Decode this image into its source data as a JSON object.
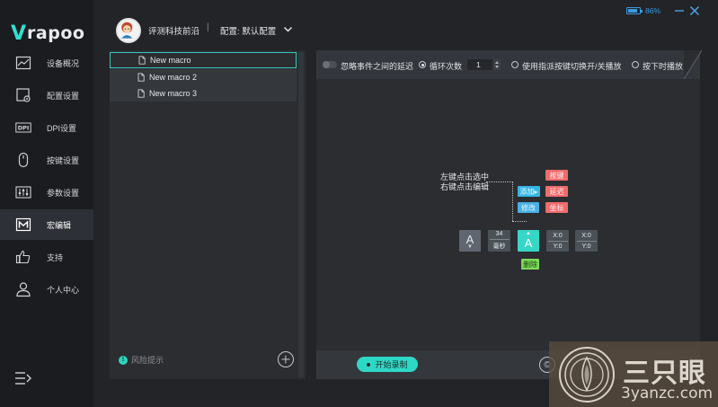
{
  "brand": {
    "logo_mark": "V",
    "logo_word": "rapoo"
  },
  "user": {
    "name": "评测科技前沿",
    "separator": "|",
    "profile": "配置: 默认配置"
  },
  "battery": {
    "level": 86,
    "text": "86%"
  },
  "sidebar": {
    "items": [
      {
        "label": "设备概况",
        "icon": "chart-icon"
      },
      {
        "label": "配置设置",
        "icon": "config-icon"
      },
      {
        "label": "DPI设置",
        "icon": "dpi-icon",
        "icon_text": "DPI"
      },
      {
        "label": "按键设置",
        "icon": "mouse-icon"
      },
      {
        "label": "参数设置",
        "icon": "sliders-icon"
      },
      {
        "label": "宏编辑",
        "icon": "macro-icon",
        "active": true
      },
      {
        "label": "支持",
        "icon": "thumbs-up-icon"
      },
      {
        "label": "个人中心",
        "icon": "person-icon"
      }
    ]
  },
  "macros": {
    "items": [
      "New macro",
      "New macro 2",
      "New macro 3"
    ],
    "selected": 0,
    "risk_label": "风险提示",
    "risk_icon_text": "!"
  },
  "editor": {
    "ignore_delay": "忽略事件之间的延迟",
    "loop_label": "循环次数",
    "loop_value": "1",
    "toggle_label": "使用指派按键切换开/关播放",
    "hold_label": "按下时播放",
    "hint_line1": "左键点击选中",
    "hint_line2": "右键点击编辑",
    "tags": {
      "add": "添加▸",
      "edit": "修改",
      "key": "按键",
      "delay": "延迟",
      "coord": "坐标",
      "delete": "删除"
    },
    "blocks": {
      "key1": "A",
      "key1_arrow": "▼",
      "time_value": "34",
      "time_unit": "毫秒",
      "key2": "A",
      "key2_arrow": "▲",
      "xy1_x": "X:0",
      "xy1_y": "Y:0",
      "xy2_x": "X:0",
      "xy2_y": "Y:0"
    },
    "record_label": "开始录制",
    "copyright_glyph": "©"
  },
  "watermark": {
    "text": "三只眼",
    "url": "3yanzc.com"
  },
  "colors": {
    "accent": "#2ed8c6",
    "blue": "#34b6e6",
    "red": "#f06b6b",
    "green": "#7cdc5a",
    "battery": "#3a9be0"
  }
}
